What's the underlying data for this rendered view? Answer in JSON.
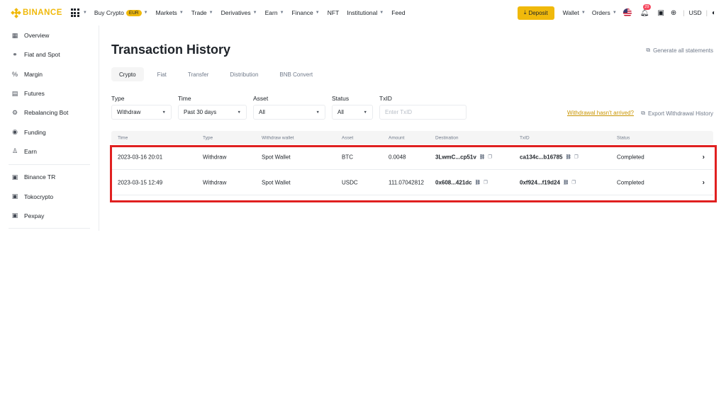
{
  "brand": {
    "name": "BINANCE",
    "color": "#f0b90b"
  },
  "nav": {
    "items": [
      {
        "label": "Buy Crypto",
        "badge": "EUR",
        "caret": true
      },
      {
        "label": "Markets",
        "caret": true
      },
      {
        "label": "Trade",
        "caret": true
      },
      {
        "label": "Derivatives",
        "caret": true
      },
      {
        "label": "Earn",
        "caret": true
      },
      {
        "label": "Finance",
        "caret": true
      },
      {
        "label": "NFT",
        "caret": false
      },
      {
        "label": "Institutional",
        "caret": true
      },
      {
        "label": "Feed",
        "caret": false
      }
    ],
    "deposit_label": "Deposit",
    "wallet_label": "Wallet",
    "orders_label": "Orders",
    "notification_count": "29",
    "currency": "USD",
    "icons": [
      "grid-icon",
      "flag-icon",
      "bell-icon",
      "download-app-icon",
      "globe-icon",
      "moon-icon"
    ]
  },
  "sidebar": {
    "items": [
      {
        "label": "Overview",
        "icon": "overview-icon"
      },
      {
        "label": "Fiat and Spot",
        "icon": "fiat-spot-icon"
      },
      {
        "label": "Margin",
        "icon": "margin-icon"
      },
      {
        "label": "Futures",
        "icon": "futures-icon"
      },
      {
        "label": "Rebalancing Bot",
        "icon": "bot-icon"
      },
      {
        "label": "Funding",
        "icon": "funding-icon"
      },
      {
        "label": "Earn",
        "icon": "earn-icon"
      }
    ],
    "items2": [
      {
        "label": "Binance TR",
        "icon": "wallet-icon"
      },
      {
        "label": "Tokocrypto",
        "icon": "wallet-icon"
      },
      {
        "label": "Pexpay",
        "icon": "wallet-icon"
      }
    ]
  },
  "page": {
    "title": "Transaction History",
    "generate_link": "Generate all statements",
    "tabs": [
      "Crypto",
      "Fiat",
      "Transfer",
      "Distribution",
      "BNB Convert"
    ],
    "active_tab": "Crypto"
  },
  "filters": {
    "type": {
      "label": "Type",
      "value": "Withdraw"
    },
    "time": {
      "label": "Time",
      "value": "Past 30 days"
    },
    "asset": {
      "label": "Asset",
      "value": "All"
    },
    "status": {
      "label": "Status",
      "value": "All"
    },
    "txid": {
      "label": "TxID",
      "placeholder": "Enter TxID"
    },
    "withdrawal_question": "Withdrawal hasn't arrived?",
    "export_link": "Export Withdrawal History"
  },
  "table": {
    "headers": [
      "Time",
      "Type",
      "Withdraw wallet",
      "Asset",
      "Amount",
      "Destination",
      "TxID",
      "Status"
    ],
    "rows": [
      {
        "time": "2023-03-16 20:01",
        "type": "Withdraw",
        "wallet": "Spot Wallet",
        "asset": "BTC",
        "amount": "0.0048",
        "destination": "3LwmC...cp51v",
        "txid": "ca134c...b16785",
        "status": "Completed"
      },
      {
        "time": "2023-03-15 12:49",
        "type": "Withdraw",
        "wallet": "Spot Wallet",
        "asset": "USDC",
        "amount": "111.07042812",
        "destination": "0x608...421dc",
        "txid": "0xf924...f19d24",
        "status": "Completed"
      }
    ]
  },
  "highlight_color": "#e02020"
}
